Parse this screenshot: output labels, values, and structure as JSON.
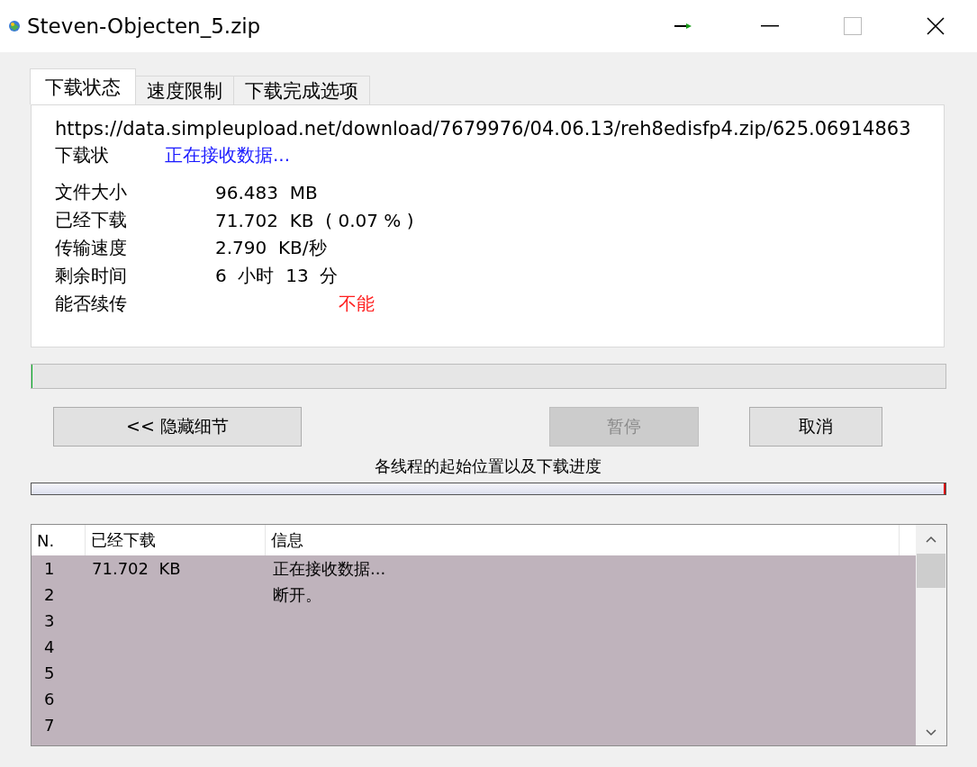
{
  "window": {
    "title": "Steven-Objecten_5.zip"
  },
  "tabs": [
    {
      "label": "下载状态",
      "selected": true
    },
    {
      "label": "速度限制",
      "selected": false
    },
    {
      "label": "下载完成选项",
      "selected": false
    }
  ],
  "url": "https://data.simpleupload.net/download/7679976/04.06.13/reh8edisfp4.zip/625.06914863",
  "status": {
    "label": "下载状",
    "value": "正在接收数据..."
  },
  "details": [
    {
      "label": "文件大小",
      "value": "96.483  MB",
      "kind": "normal"
    },
    {
      "label": "已经下载",
      "value": "71.702  KB  ( 0.07 % )",
      "kind": "normal"
    },
    {
      "label": "传输速度",
      "value": "2.790  KB/秒",
      "kind": "normal"
    },
    {
      "label": "剩余时间",
      "value": "6  小时  13  分",
      "kind": "normal"
    },
    {
      "label": "能否续传",
      "value": "不能",
      "kind": "alert"
    }
  ],
  "progress": {
    "level": 0.0007
  },
  "buttons": [
    {
      "label": "<< 隐藏细节",
      "disabled": false
    },
    {
      "label": "暂停",
      "disabled": true
    },
    {
      "label": "取消",
      "disabled": false
    }
  ],
  "threads_caption": "各线程的起始位置以及下载进度",
  "threads_progress": {
    "level": 0.002
  },
  "table": {
    "columns": [
      "N.",
      "已经下载",
      "信息"
    ],
    "rows": [
      [
        "1",
        "71.702  KB",
        "正在接收数据..."
      ],
      [
        "2",
        "",
        "断开。"
      ],
      [
        "3",
        "",
        ""
      ],
      [
        "4",
        "",
        ""
      ],
      [
        "5",
        "",
        ""
      ],
      [
        "6",
        "",
        ""
      ],
      [
        "7",
        "",
        ""
      ]
    ]
  }
}
